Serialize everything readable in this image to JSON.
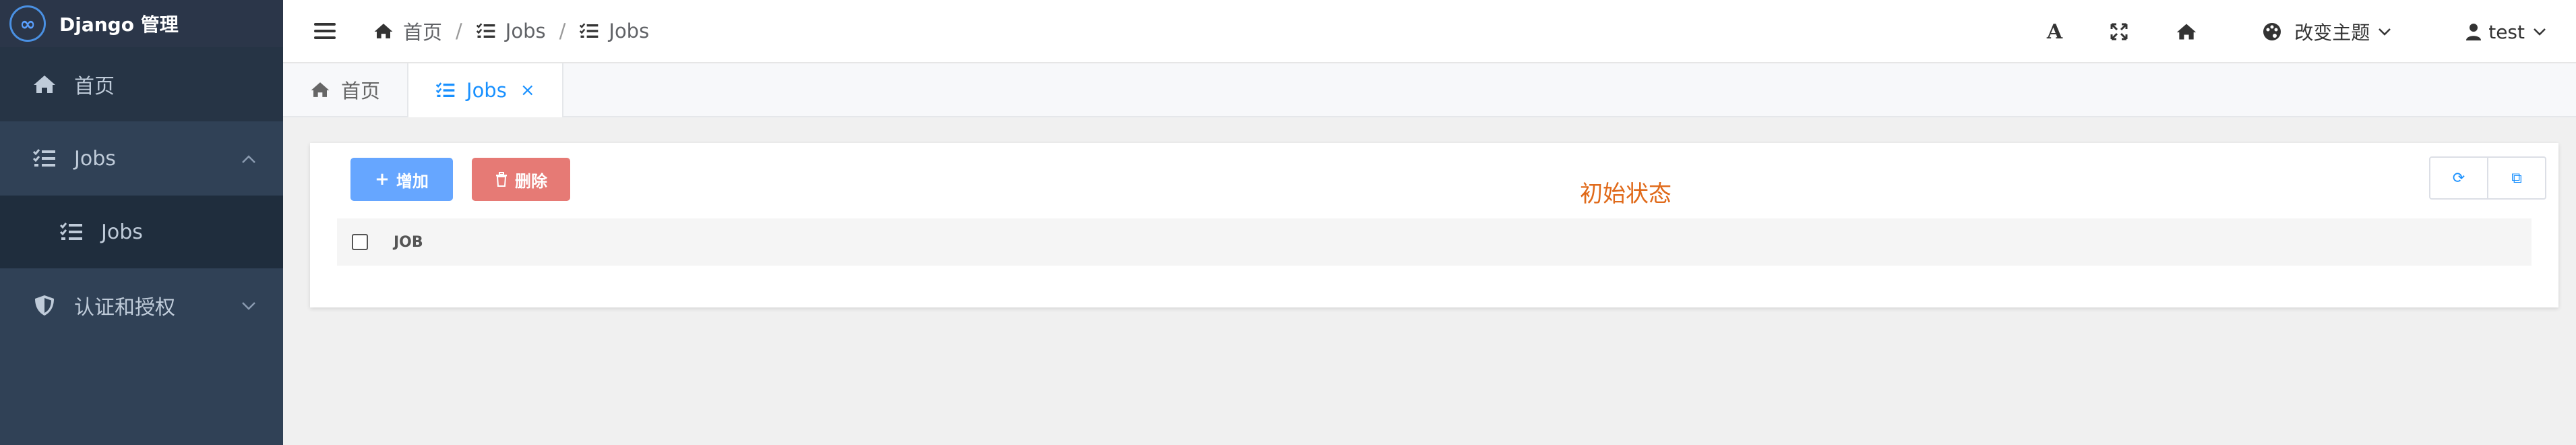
{
  "brand": {
    "title": "Django 管理",
    "logo_glyph": "∞"
  },
  "sidebar": {
    "items": [
      {
        "label": "首页",
        "icon": "home-icon"
      },
      {
        "label": "Jobs",
        "icon": "list-check-icon",
        "expanded": true,
        "children": [
          {
            "label": "Jobs",
            "icon": "list-check-icon"
          }
        ]
      },
      {
        "label": "认证和授权",
        "icon": "shield-icon",
        "expanded": false
      }
    ]
  },
  "header": {
    "breadcrumb": [
      {
        "label": "首页",
        "icon": "home-icon"
      },
      {
        "label": "Jobs",
        "icon": "list-check-icon"
      },
      {
        "label": "Jobs",
        "icon": "list-check-icon"
      }
    ],
    "separator": "/",
    "font_size_glyph": "A",
    "theme_label": "改变主题",
    "user_label": "test"
  },
  "tabs": [
    {
      "label": "首页",
      "icon": "home-icon",
      "active": false
    },
    {
      "label": "Jobs",
      "icon": "list-check-icon",
      "active": true,
      "close_glyph": "×"
    }
  ],
  "content": {
    "add_label": "增加",
    "add_glyph": "+",
    "delete_label": "删除",
    "state_text": "初始状态",
    "refresh_glyph": "⟳",
    "export_glyph": "⧉",
    "table": {
      "columns": [
        "JOB"
      ]
    }
  },
  "colors": {
    "sidebar_bg": "#304156",
    "accent": "#1890ff",
    "add_button": "#66a6ff",
    "delete_button": "#e67a75",
    "state_text": "#e06a1a"
  }
}
